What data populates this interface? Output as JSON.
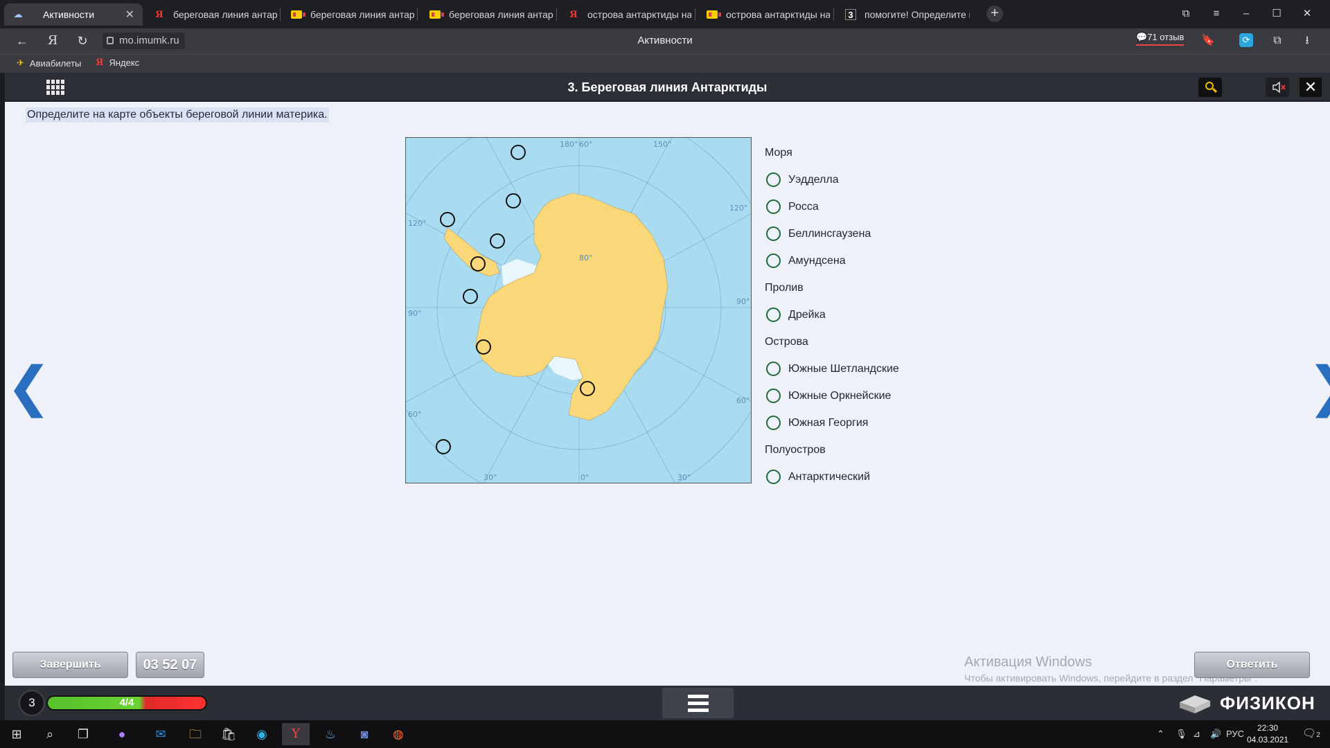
{
  "browser": {
    "tabs": [
      {
        "icon": "cloud",
        "label": "Активности",
        "active": true
      },
      {
        "icon": "yandex",
        "label": "береговая линия антаркт"
      },
      {
        "icon": "card",
        "label": "береговая линия антаркт"
      },
      {
        "icon": "card",
        "label": "береговая линия антаркт"
      },
      {
        "icon": "yandex",
        "label": "острова антарктиды на ка"
      },
      {
        "icon": "card",
        "label": "острова антарктиды на ка"
      },
      {
        "icon": "digit",
        "icon_text": "3",
        "label": "помогите! Определите на"
      }
    ],
    "address": "mo.imumk.ru",
    "page_title": "Активности",
    "reviews": "71 отзыв",
    "bookmarks": [
      {
        "icon": "plane",
        "label": "Авиабилеты"
      },
      {
        "icon": "yandex",
        "label": "Яндекс"
      }
    ]
  },
  "app": {
    "title": "3. Береговая линия Антарктиды",
    "instruction": "Определите на карте объекты береговой линии материка.",
    "map": {
      "labels": [
        {
          "text": "180°"
        },
        {
          "text": "60°"
        },
        {
          "text": "150°"
        },
        {
          "text": "120°"
        },
        {
          "text": "120°"
        },
        {
          "text": "80°"
        },
        {
          "text": "90°"
        },
        {
          "text": "90°"
        },
        {
          "text": "60°"
        },
        {
          "text": "60°"
        },
        {
          "text": "30°"
        },
        {
          "text": "0°"
        },
        {
          "text": "30°"
        }
      ],
      "colors": {
        "ocean": "#a9dcf0",
        "land": "#fad879",
        "ice": "#e9f6fb",
        "grid": "#7fb2d3"
      }
    },
    "groups": [
      {
        "title": "Моря",
        "options": [
          "Уэдделла",
          "Росса",
          "Беллинсгаузена",
          "Амундсена"
        ]
      },
      {
        "title": "Пролив",
        "options": [
          "Дрейка"
        ]
      },
      {
        "title": "Острова",
        "options": [
          "Южные Шетландские",
          "Южные Оркнейские",
          "Южная Георгия"
        ]
      },
      {
        "title": "Полуостров",
        "options": [
          "Антарктический"
        ]
      }
    ],
    "finish_label": "Завершить",
    "timer": "03 52 07",
    "answer_label": "Ответить",
    "level": "3",
    "progress_text": "4/4",
    "progress_fraction": 0.6,
    "brand": "ФИЗИКОН"
  },
  "watermark": {
    "line1": "Активация Windows",
    "line2": "Чтобы активировать Windows, перейдите в раздел \"Параметры\"."
  },
  "taskbar": {
    "lang": "РУС",
    "time": "22:30",
    "date": "04.03.2021",
    "notifications": "2"
  }
}
